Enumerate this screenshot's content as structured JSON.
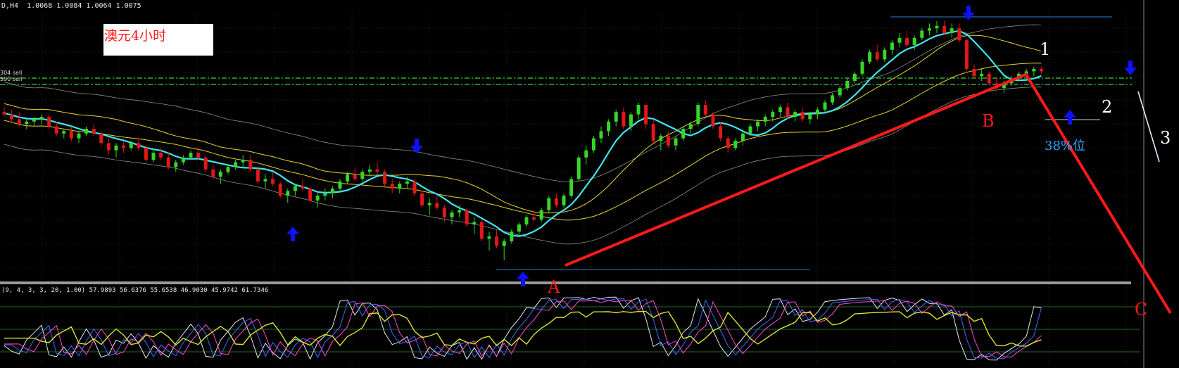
{
  "header": {
    "main_info": "D,H4  1.0068 1.0084 1.0064 1.0075",
    "indicator_info": "(9, 4, 3, 3, 20, 1.00) 57.9893 56.6376 55.6538 46.9030 45.9742 61.7346",
    "sell_tag_1": "304 sell",
    "sell_tag_2": "590 sell"
  },
  "title": "澳元4小时",
  "annotations": {
    "point_a": "A",
    "point_b": "B",
    "point_c": "C",
    "wave_1": "1",
    "wave_2": "2",
    "wave_3": "3",
    "fib_label": "38%位"
  },
  "icons": [
    "arrow-up-icon",
    "arrow-down-icon"
  ],
  "colors": {
    "background": "#000000",
    "bull_candle": "#36d629",
    "bear_candle": "#e01818",
    "fast_ma": "#3fe6f0",
    "slow_ma": "#e8d22c",
    "envelope": "#8a8f8a",
    "sell_lines": "#33d633",
    "trend_line": "#ff1a1a",
    "signal_arrows": "#1010ff",
    "support_resistance": "#2b7fd6"
  },
  "chart_data": {
    "type": "candlestick",
    "timeframe": "H4",
    "price_scale": "unlabeled (chart-relative 0–100, 0 = lowest low, 100 = highest high)",
    "candles": [
      [
        62,
        64,
        60,
        61
      ],
      [
        61,
        63,
        58,
        59
      ],
      [
        59,
        62,
        56,
        57
      ],
      [
        57,
        59,
        55,
        58
      ],
      [
        58,
        60,
        56,
        59
      ],
      [
        59,
        61,
        57,
        60
      ],
      [
        60,
        61,
        55,
        56
      ],
      [
        56,
        58,
        52,
        53
      ],
      [
        53,
        55,
        51,
        54
      ],
      [
        54,
        56,
        50,
        51
      ],
      [
        51,
        54,
        49,
        53
      ],
      [
        53,
        56,
        52,
        55
      ],
      [
        55,
        57,
        52,
        53
      ],
      [
        53,
        54,
        48,
        49
      ],
      [
        49,
        51,
        44,
        46
      ],
      [
        46,
        49,
        43,
        48
      ],
      [
        48,
        50,
        45,
        47
      ],
      [
        47,
        50,
        46,
        49
      ],
      [
        49,
        51,
        46,
        47
      ],
      [
        47,
        48,
        41,
        42
      ],
      [
        42,
        46,
        41,
        45
      ],
      [
        45,
        47,
        42,
        43
      ],
      [
        43,
        45,
        38,
        39
      ],
      [
        39,
        42,
        37,
        41
      ],
      [
        41,
        44,
        40,
        43
      ],
      [
        43,
        46,
        42,
        45
      ],
      [
        45,
        47,
        42,
        43
      ],
      [
        43,
        44,
        37,
        38
      ],
      [
        38,
        40,
        34,
        35
      ],
      [
        35,
        38,
        32,
        37
      ],
      [
        37,
        40,
        36,
        39
      ],
      [
        39,
        42,
        38,
        41
      ],
      [
        41,
        44,
        39,
        42
      ],
      [
        42,
        44,
        37,
        38
      ],
      [
        38,
        39,
        32,
        33
      ],
      [
        33,
        36,
        30,
        34
      ],
      [
        34,
        37,
        31,
        32
      ],
      [
        32,
        33,
        26,
        27
      ],
      [
        27,
        30,
        24,
        29
      ],
      [
        29,
        32,
        27,
        31
      ],
      [
        31,
        34,
        29,
        30
      ],
      [
        30,
        31,
        24,
        25
      ],
      [
        25,
        28,
        22,
        27
      ],
      [
        27,
        30,
        25,
        28
      ],
      [
        28,
        31,
        26,
        30
      ],
      [
        30,
        34,
        29,
        33
      ],
      [
        33,
        37,
        32,
        36
      ],
      [
        36,
        39,
        33,
        34
      ],
      [
        34,
        38,
        33,
        37
      ],
      [
        37,
        40,
        35,
        38
      ],
      [
        38,
        41,
        36,
        37
      ],
      [
        37,
        38,
        31,
        32
      ],
      [
        32,
        34,
        28,
        30
      ],
      [
        30,
        33,
        28,
        32
      ],
      [
        32,
        35,
        30,
        33
      ],
      [
        33,
        34,
        27,
        28
      ],
      [
        28,
        29,
        22,
        23
      ],
      [
        23,
        26,
        19,
        24
      ],
      [
        24,
        27,
        21,
        22
      ],
      [
        22,
        23,
        16,
        18
      ],
      [
        18,
        21,
        15,
        20
      ],
      [
        20,
        23,
        18,
        21
      ],
      [
        21,
        22,
        14,
        15
      ],
      [
        15,
        18,
        11,
        16
      ],
      [
        16,
        17,
        8,
        9
      ],
      [
        9,
        12,
        4,
        10
      ],
      [
        10,
        13,
        5,
        6
      ],
      [
        6,
        9,
        0,
        8
      ],
      [
        8,
        13,
        7,
        12
      ],
      [
        12,
        16,
        11,
        15
      ],
      [
        15,
        19,
        14,
        18
      ],
      [
        18,
        21,
        16,
        17
      ],
      [
        17,
        22,
        16,
        21
      ],
      [
        21,
        27,
        20,
        26
      ],
      [
        26,
        28,
        22,
        23
      ],
      [
        23,
        28,
        22,
        27
      ],
      [
        27,
        35,
        26,
        34
      ],
      [
        34,
        44,
        33,
        43
      ],
      [
        43,
        48,
        40,
        46
      ],
      [
        46,
        52,
        45,
        51
      ],
      [
        51,
        56,
        49,
        54
      ],
      [
        54,
        59,
        52,
        58
      ],
      [
        58,
        63,
        56,
        62
      ],
      [
        62,
        64,
        55,
        56
      ],
      [
        56,
        62,
        54,
        61
      ],
      [
        61,
        66,
        59,
        65
      ],
      [
        65,
        64,
        55,
        57
      ],
      [
        57,
        59,
        49,
        50
      ],
      [
        50,
        53,
        46,
        52
      ],
      [
        52,
        54,
        47,
        48
      ],
      [
        48,
        52,
        46,
        51
      ],
      [
        51,
        56,
        50,
        55
      ],
      [
        55,
        58,
        53,
        57
      ],
      [
        57,
        66,
        56,
        65
      ],
      [
        65,
        67,
        60,
        61
      ],
      [
        61,
        62,
        55,
        56
      ],
      [
        56,
        58,
        50,
        51
      ],
      [
        51,
        52,
        45,
        47
      ],
      [
        47,
        51,
        46,
        50
      ],
      [
        50,
        54,
        48,
        53
      ],
      [
        53,
        57,
        52,
        56
      ],
      [
        56,
        59,
        54,
        58
      ],
      [
        58,
        61,
        56,
        60
      ],
      [
        60,
        63,
        58,
        62
      ],
      [
        62,
        65,
        60,
        64
      ],
      [
        64,
        66,
        59,
        60
      ],
      [
        60,
        63,
        58,
        62
      ],
      [
        62,
        64,
        58,
        59
      ],
      [
        59,
        62,
        57,
        61
      ],
      [
        61,
        64,
        59,
        63
      ],
      [
        63,
        67,
        62,
        66
      ],
      [
        66,
        70,
        65,
        69
      ],
      [
        69,
        73,
        68,
        72
      ],
      [
        72,
        76,
        71,
        75
      ],
      [
        75,
        79,
        74,
        78
      ],
      [
        78,
        84,
        77,
        83
      ],
      [
        83,
        88,
        82,
        87
      ],
      [
        87,
        90,
        83,
        84
      ],
      [
        84,
        89,
        83,
        88
      ],
      [
        88,
        92,
        86,
        91
      ],
      [
        91,
        95,
        89,
        93
      ],
      [
        93,
        96,
        89,
        90
      ],
      [
        90,
        94,
        88,
        93
      ],
      [
        93,
        97,
        92,
        96
      ],
      [
        96,
        99,
        94,
        97
      ],
      [
        97,
        100,
        95,
        98
      ],
      [
        98,
        100,
        94,
        95
      ],
      [
        95,
        99,
        93,
        97
      ],
      [
        97,
        99,
        91,
        92
      ],
      [
        92,
        93,
        79,
        80
      ],
      [
        80,
        82,
        76,
        77
      ],
      [
        77,
        80,
        75,
        78
      ],
      [
        78,
        79,
        73,
        74
      ],
      [
        74,
        76,
        71,
        72
      ],
      [
        72,
        75,
        70,
        74
      ],
      [
        74,
        77,
        73,
        76
      ],
      [
        76,
        79,
        75,
        78
      ],
      [
        78,
        80,
        76,
        79
      ],
      [
        79,
        81,
        77,
        80
      ],
      [
        80,
        81,
        78,
        79
      ]
    ],
    "overlays": [
      {
        "name": "fast_ma",
        "color": "#3fe6f0"
      },
      {
        "name": "slow_ma",
        "color": "#e8d22c"
      },
      {
        "name": "envelope",
        "color": "#8a8f8a"
      }
    ],
    "annotation_points": {
      "A": {
        "candle": 70,
        "level": 2
      },
      "B": {
        "candle": 136,
        "level": 78
      },
      "C": {
        "candle": 160,
        "level": -62
      }
    }
  }
}
